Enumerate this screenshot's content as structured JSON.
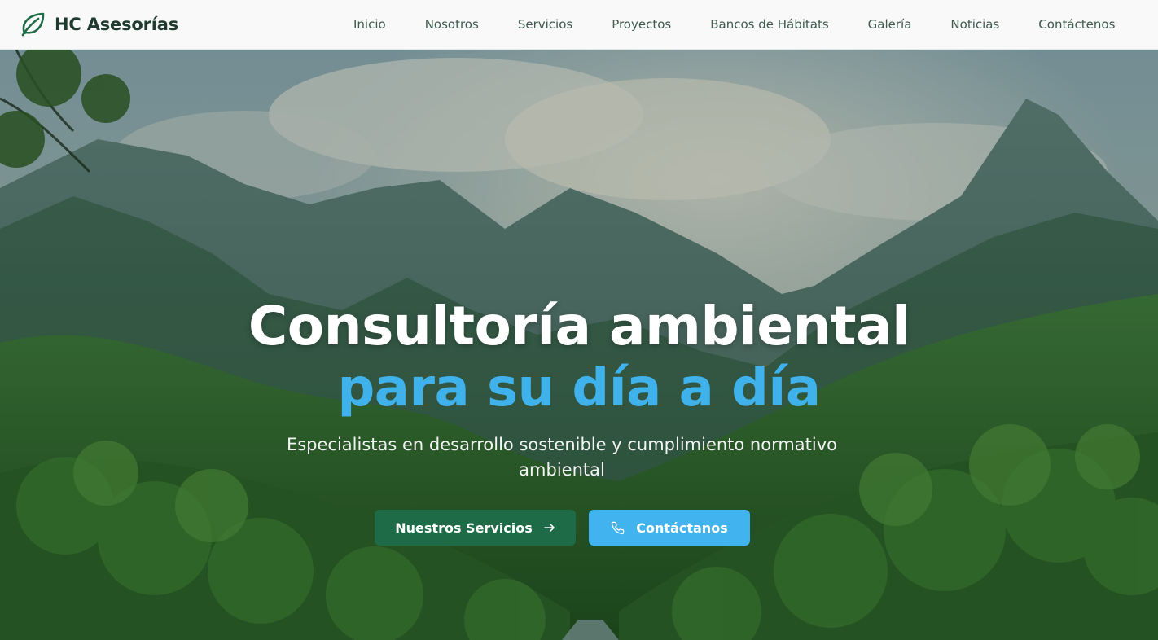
{
  "brand": {
    "name": "HC Asesorías",
    "logo_icon": "leaf-icon",
    "accent": "#1e6b47"
  },
  "nav": {
    "items": [
      {
        "label": "Inicio"
      },
      {
        "label": "Nosotros"
      },
      {
        "label": "Servicios"
      },
      {
        "label": "Proyectos"
      },
      {
        "label": "Bancos de Hábitats"
      },
      {
        "label": "Galería"
      },
      {
        "label": "Noticias"
      },
      {
        "label": "Contáctenos"
      }
    ]
  },
  "hero": {
    "background_image": "forest-mountain-valley",
    "title_line1": "Consultoría ambiental",
    "title_line2": "para su día a día",
    "title_line2_color": "#3fb2ec",
    "subtitle": "Especialistas en desarrollo sostenible y cumplimiento normativo ambiental",
    "primary_button": {
      "label": "Nuestros Servicios",
      "icon": "arrow-right-icon",
      "color": "#1e6b47"
    },
    "secondary_button": {
      "label": "Contáctanos",
      "icon": "phone-icon",
      "color": "#41b4ef"
    }
  }
}
